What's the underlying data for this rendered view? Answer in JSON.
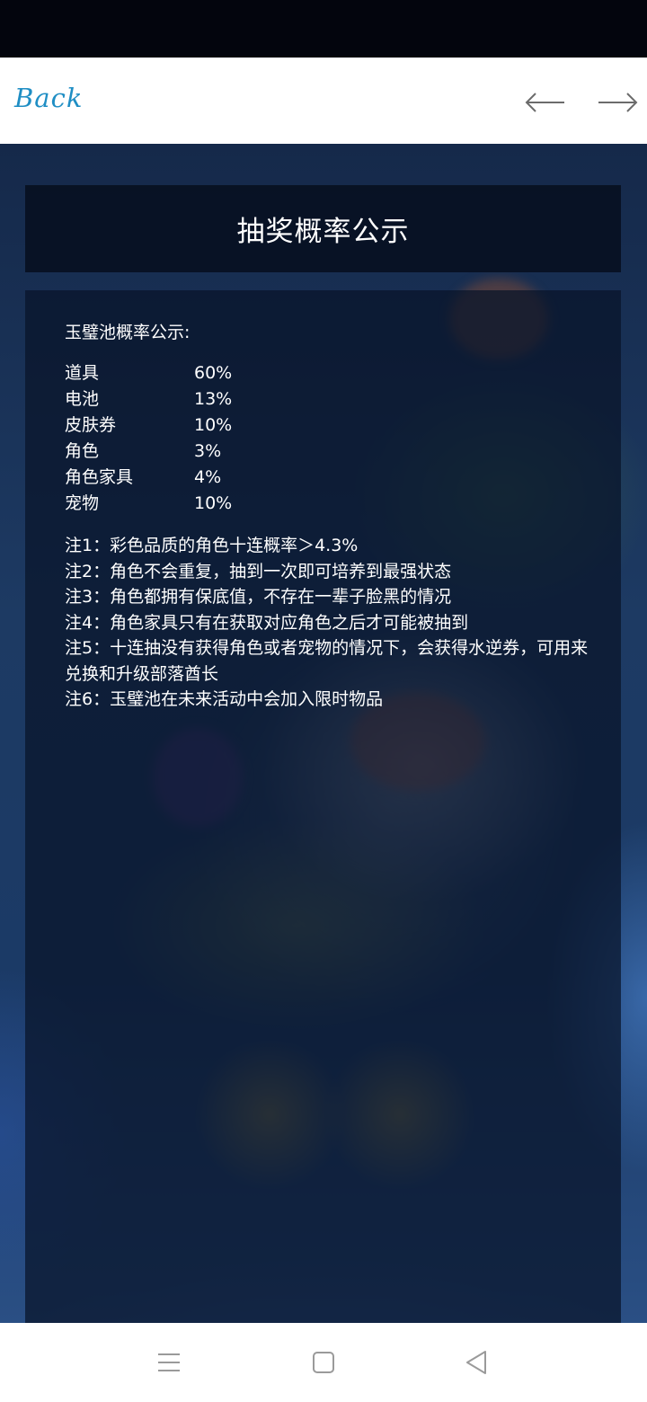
{
  "nav": {
    "back_label": "Back",
    "prev_icon": "arrow-left-icon",
    "next_icon": "arrow-right-icon"
  },
  "page": {
    "title": "抽奖概率公示"
  },
  "pool": {
    "heading": "玉璧池概率公示:",
    "items": [
      {
        "name": "道具",
        "value": "60%"
      },
      {
        "name": "电池",
        "value": "13%"
      },
      {
        "name": "皮肤券",
        "value": "10%"
      },
      {
        "name": "角色",
        "value": "3%"
      },
      {
        "name": "角色家具",
        "value": "4%"
      },
      {
        "name": "宠物",
        "value": "10%"
      }
    ],
    "notes": [
      "注1：彩色品质的角色十连概率＞4.3%",
      "注2：角色不会重复，抽到一次即可培养到最强状态",
      "注3：角色都拥有保底值，不存在一辈子脸黑的情况",
      "注4：角色家具只有在获取对应角色之后才可能被抽到",
      "注5：十连抽没有获得角色或者宠物的情况下，会获得水逆券，可用来兑换和升级部落酋长",
      "注6：玉璧池在未来活动中会加入限时物品"
    ]
  },
  "system_nav": {
    "menu_icon": "menu-icon",
    "home_icon": "home-square-icon",
    "back_icon": "back-triangle-icon"
  },
  "colors": {
    "back_link": "#1f8ec4",
    "panel_bg": "#091328",
    "text": "#ffffff"
  }
}
